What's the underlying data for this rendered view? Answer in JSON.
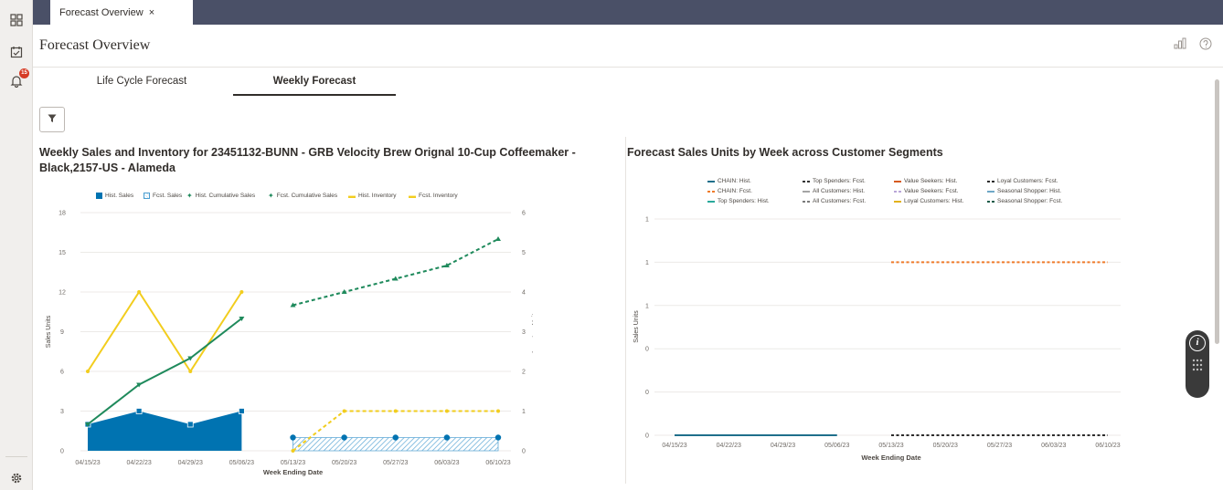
{
  "nav_rail": {
    "icons": [
      "grid-icon",
      "calendar-check-icon",
      "bell-icon",
      "settings-icon"
    ],
    "notification_count": "15"
  },
  "tab_bar": {
    "tab_label": "Forecast Overview",
    "close_glyph": "×"
  },
  "header": {
    "title": "Forecast Overview"
  },
  "subtabs": [
    {
      "label": "Life Cycle Forecast",
      "active": false
    },
    {
      "label": "Weekly Forecast",
      "active": true
    }
  ],
  "chart_left": {
    "title_line1": "Weekly Sales and Inventory for 23451132-BUNN - GRB Velocity Brew Orignal 10-Cup Coffeemaker -",
    "title_line2": "Black,2157-US - Alameda",
    "legend": [
      "Hist. Sales",
      "Fcst. Sales",
      "Hist. Cumulative Sales",
      "Fcst. Cumulative Sales",
      "Hist. Inventory",
      "Fcst. Inventory"
    ],
    "colors": {
      "sales": "#0073b1",
      "cumulative": "#1f8a5c",
      "inventory": "#f2cd1e"
    }
  },
  "chart_right": {
    "title": "Forecast Sales Units by Week across Customer Segments",
    "legend": [
      {
        "label": "CHAIN: Hist.",
        "color": "#1f6f8b",
        "dash": false
      },
      {
        "label": "Top Spenders: Fcst.",
        "color": "#333333",
        "dash": true
      },
      {
        "label": "Value Seekers: Hist.",
        "color": "#d65a1f",
        "dash": false
      },
      {
        "label": "Loyal Customers: Fcst.",
        "color": "#2c2c2c",
        "dash": true
      },
      {
        "label": "CHAIN: Fcst.",
        "color": "#f07b2a",
        "dash": true
      },
      {
        "label": "All Customers: Hist.",
        "color": "#a4a4a4",
        "dash": false
      },
      {
        "label": "Value Seekers: Fcst.",
        "color": "#b9a6d8",
        "dash": true
      },
      {
        "label": "Seasonal Shopper: Hist.",
        "color": "#6fa8c7",
        "dash": false
      },
      {
        "label": "Top Spenders: Hist.",
        "color": "#29a99b",
        "dash": false
      },
      {
        "label": "All Customers: Fcst.",
        "color": "#7a7a7a",
        "dash": true
      },
      {
        "label": "Loyal Customers: Hist.",
        "color": "#e2b21c",
        "dash": false
      },
      {
        "label": "Seasonal Shopper: Fcst.",
        "color": "#1f5c4a",
        "dash": true
      }
    ]
  },
  "chart_data": [
    {
      "type": "bar",
      "categories": [
        "04/15/23",
        "04/22/23",
        "04/29/23",
        "05/06/23",
        "05/13/23",
        "05/20/23",
        "05/27/23",
        "06/03/23",
        "06/10/23"
      ],
      "xlabel": "Week Ending Date",
      "ylabel": "Sales Units",
      "y2label": "Inventory Units",
      "ylim": [
        0,
        18
      ],
      "yticks": [
        "0",
        "3",
        "6",
        "9",
        "12",
        "15",
        "18"
      ],
      "y2lim": [
        0,
        6
      ],
      "y2ticks": [
        "0",
        "1",
        "2",
        "3",
        "4",
        "5",
        "6"
      ],
      "series": [
        {
          "name": "Hist. Sales",
          "type": "area",
          "values": [
            2,
            3,
            2,
            3,
            null,
            null,
            null,
            null,
            null
          ]
        },
        {
          "name": "Fcst. Sales",
          "type": "area",
          "values": [
            null,
            null,
            null,
            null,
            1,
            1,
            1,
            1,
            1
          ]
        },
        {
          "name": "Hist. Cumulative Sales",
          "type": "line",
          "values": [
            2,
            5,
            7,
            10,
            null,
            null,
            null,
            null,
            null
          ]
        },
        {
          "name": "Fcst. Cumulative Sales",
          "type": "line",
          "values": [
            null,
            null,
            null,
            null,
            11,
            12,
            13,
            14,
            16
          ]
        },
        {
          "name": "Hist. Inventory",
          "type": "line",
          "axis": "y2",
          "values": [
            2,
            4,
            2,
            4,
            null,
            null,
            null,
            null,
            null
          ]
        },
        {
          "name": "Fcst. Inventory",
          "type": "line",
          "axis": "y2",
          "values": [
            null,
            null,
            null,
            null,
            0,
            1,
            1,
            1,
            1
          ]
        }
      ],
      "grid": true,
      "legend_position": "top"
    },
    {
      "type": "line",
      "categories": [
        "04/15/23",
        "04/22/23",
        "04/29/23",
        "05/06/23",
        "05/13/23",
        "05/20/23",
        "05/27/23",
        "06/03/23",
        "06/10/23"
      ],
      "xlabel": "Week Ending Date",
      "ylabel": "Sales Units",
      "yticks": [
        "0",
        "0",
        "0",
        "1",
        "1",
        "1"
      ],
      "series": [
        {
          "name": "CHAIN: Hist.",
          "values": [
            0,
            0,
            0,
            0,
            null,
            null,
            null,
            null,
            null
          ]
        },
        {
          "name": "CHAIN: Fcst.",
          "values": [
            null,
            null,
            null,
            null,
            1,
            1,
            1,
            1,
            1
          ]
        },
        {
          "name": "Loyal Customers: Fcst.",
          "values": [
            null,
            null,
            null,
            null,
            0,
            0,
            0,
            0,
            0
          ]
        }
      ],
      "grid": true,
      "legend_position": "top"
    }
  ]
}
